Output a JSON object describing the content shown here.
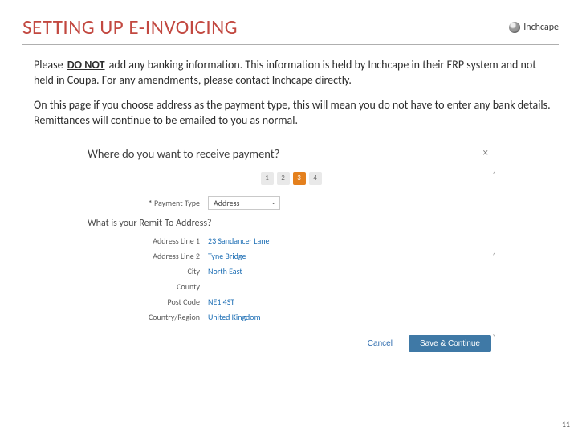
{
  "header": {
    "title": "SETTING UP E-INVOICING",
    "brand": "Inchcape"
  },
  "body": {
    "para1_pre": "Please ",
    "para1_donot": "DO NOT",
    "para1_post": " add any banking information. This information is held by Inchcape in their ERP system and not held in Coupa. For any amendments, please contact Inchcape directly.",
    "para2": "On this page if you choose address as the payment type, this will mean you do not have to enter any bank details. Remittances will continue to be emailed to you as normal."
  },
  "modal": {
    "title": "Where do you want to receive payment?",
    "close": "×",
    "steps": [
      "1",
      "2",
      "3",
      "4"
    ],
    "active_step_index": 2,
    "payment_type_label": "Payment Type",
    "payment_type_value": "Address",
    "remit_heading": "What is your Remit-To Address?",
    "fields": {
      "addr1": {
        "label": "Address Line 1",
        "value": "23 Sandancer Lane"
      },
      "addr2": {
        "label": "Address Line 2",
        "value": "Tyne Bridge"
      },
      "city": {
        "label": "City",
        "value": "North East"
      },
      "county": {
        "label": "County",
        "value": ""
      },
      "post": {
        "label": "Post Code",
        "value": "NE1 4ST"
      },
      "country": {
        "label": "Country/Region",
        "value": "United Kingdom"
      }
    },
    "footer": {
      "cancel": "Cancel",
      "primary": "Save & Continue"
    }
  },
  "pagenum": "11"
}
